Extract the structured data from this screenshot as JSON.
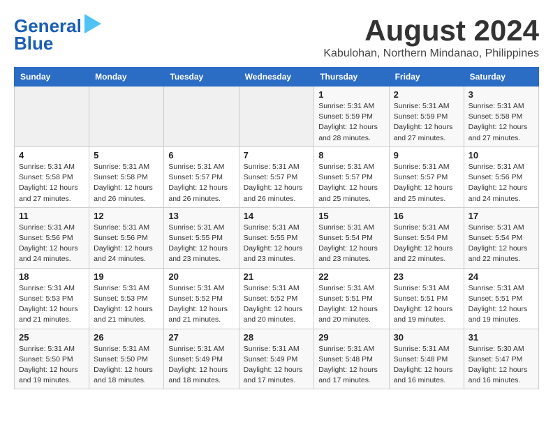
{
  "header": {
    "logo_line1": "General",
    "logo_line2": "Blue",
    "month_year": "August 2024",
    "location": "Kabulohan, Northern Mindanao, Philippines"
  },
  "weekdays": [
    "Sunday",
    "Monday",
    "Tuesday",
    "Wednesday",
    "Thursday",
    "Friday",
    "Saturday"
  ],
  "weeks": [
    [
      {
        "day": "",
        "info": ""
      },
      {
        "day": "",
        "info": ""
      },
      {
        "day": "",
        "info": ""
      },
      {
        "day": "",
        "info": ""
      },
      {
        "day": "1",
        "info": "Sunrise: 5:31 AM\nSunset: 5:59 PM\nDaylight: 12 hours\nand 28 minutes."
      },
      {
        "day": "2",
        "info": "Sunrise: 5:31 AM\nSunset: 5:59 PM\nDaylight: 12 hours\nand 27 minutes."
      },
      {
        "day": "3",
        "info": "Sunrise: 5:31 AM\nSunset: 5:58 PM\nDaylight: 12 hours\nand 27 minutes."
      }
    ],
    [
      {
        "day": "4",
        "info": "Sunrise: 5:31 AM\nSunset: 5:58 PM\nDaylight: 12 hours\nand 27 minutes."
      },
      {
        "day": "5",
        "info": "Sunrise: 5:31 AM\nSunset: 5:58 PM\nDaylight: 12 hours\nand 26 minutes."
      },
      {
        "day": "6",
        "info": "Sunrise: 5:31 AM\nSunset: 5:57 PM\nDaylight: 12 hours\nand 26 minutes."
      },
      {
        "day": "7",
        "info": "Sunrise: 5:31 AM\nSunset: 5:57 PM\nDaylight: 12 hours\nand 26 minutes."
      },
      {
        "day": "8",
        "info": "Sunrise: 5:31 AM\nSunset: 5:57 PM\nDaylight: 12 hours\nand 25 minutes."
      },
      {
        "day": "9",
        "info": "Sunrise: 5:31 AM\nSunset: 5:57 PM\nDaylight: 12 hours\nand 25 minutes."
      },
      {
        "day": "10",
        "info": "Sunrise: 5:31 AM\nSunset: 5:56 PM\nDaylight: 12 hours\nand 24 minutes."
      }
    ],
    [
      {
        "day": "11",
        "info": "Sunrise: 5:31 AM\nSunset: 5:56 PM\nDaylight: 12 hours\nand 24 minutes."
      },
      {
        "day": "12",
        "info": "Sunrise: 5:31 AM\nSunset: 5:56 PM\nDaylight: 12 hours\nand 24 minutes."
      },
      {
        "day": "13",
        "info": "Sunrise: 5:31 AM\nSunset: 5:55 PM\nDaylight: 12 hours\nand 23 minutes."
      },
      {
        "day": "14",
        "info": "Sunrise: 5:31 AM\nSunset: 5:55 PM\nDaylight: 12 hours\nand 23 minutes."
      },
      {
        "day": "15",
        "info": "Sunrise: 5:31 AM\nSunset: 5:54 PM\nDaylight: 12 hours\nand 23 minutes."
      },
      {
        "day": "16",
        "info": "Sunrise: 5:31 AM\nSunset: 5:54 PM\nDaylight: 12 hours\nand 22 minutes."
      },
      {
        "day": "17",
        "info": "Sunrise: 5:31 AM\nSunset: 5:54 PM\nDaylight: 12 hours\nand 22 minutes."
      }
    ],
    [
      {
        "day": "18",
        "info": "Sunrise: 5:31 AM\nSunset: 5:53 PM\nDaylight: 12 hours\nand 21 minutes."
      },
      {
        "day": "19",
        "info": "Sunrise: 5:31 AM\nSunset: 5:53 PM\nDaylight: 12 hours\nand 21 minutes."
      },
      {
        "day": "20",
        "info": "Sunrise: 5:31 AM\nSunset: 5:52 PM\nDaylight: 12 hours\nand 21 minutes."
      },
      {
        "day": "21",
        "info": "Sunrise: 5:31 AM\nSunset: 5:52 PM\nDaylight: 12 hours\nand 20 minutes."
      },
      {
        "day": "22",
        "info": "Sunrise: 5:31 AM\nSunset: 5:51 PM\nDaylight: 12 hours\nand 20 minutes."
      },
      {
        "day": "23",
        "info": "Sunrise: 5:31 AM\nSunset: 5:51 PM\nDaylight: 12 hours\nand 19 minutes."
      },
      {
        "day": "24",
        "info": "Sunrise: 5:31 AM\nSunset: 5:51 PM\nDaylight: 12 hours\nand 19 minutes."
      }
    ],
    [
      {
        "day": "25",
        "info": "Sunrise: 5:31 AM\nSunset: 5:50 PM\nDaylight: 12 hours\nand 19 minutes."
      },
      {
        "day": "26",
        "info": "Sunrise: 5:31 AM\nSunset: 5:50 PM\nDaylight: 12 hours\nand 18 minutes."
      },
      {
        "day": "27",
        "info": "Sunrise: 5:31 AM\nSunset: 5:49 PM\nDaylight: 12 hours\nand 18 minutes."
      },
      {
        "day": "28",
        "info": "Sunrise: 5:31 AM\nSunset: 5:49 PM\nDaylight: 12 hours\nand 17 minutes."
      },
      {
        "day": "29",
        "info": "Sunrise: 5:31 AM\nSunset: 5:48 PM\nDaylight: 12 hours\nand 17 minutes."
      },
      {
        "day": "30",
        "info": "Sunrise: 5:31 AM\nSunset: 5:48 PM\nDaylight: 12 hours\nand 16 minutes."
      },
      {
        "day": "31",
        "info": "Sunrise: 5:30 AM\nSunset: 5:47 PM\nDaylight: 12 hours\nand 16 minutes."
      }
    ]
  ]
}
